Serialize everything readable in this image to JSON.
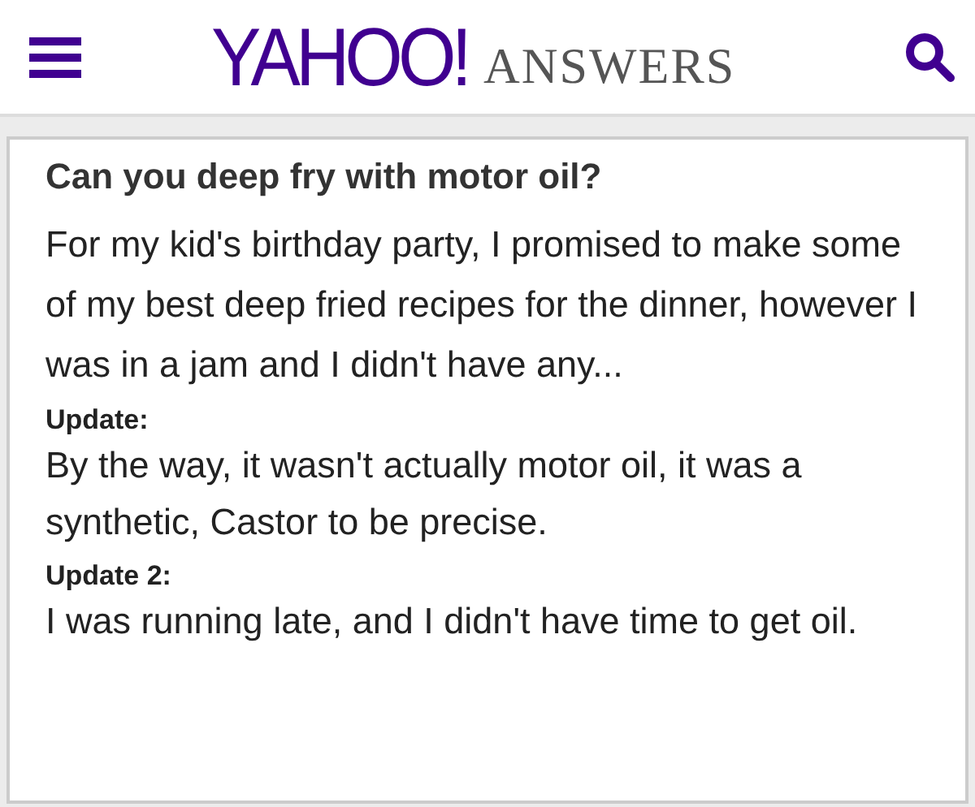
{
  "header": {
    "logo": "YAHOO!",
    "section": "ANSWERS"
  },
  "question": {
    "title": "Can you deep fry with motor oil?",
    "body": "For my kid's birthday party, I promised to make some of my best deep fried recipes for the dinner, however I was in a jam and I didn't have any...",
    "updates": [
      {
        "label": "Update:",
        "text": "By the way, it wasn't actually motor oil, it was a synthetic, Castor to be precise."
      },
      {
        "label": "Update 2:",
        "text": "I was running late, and I didn't have time to get oil."
      }
    ]
  }
}
